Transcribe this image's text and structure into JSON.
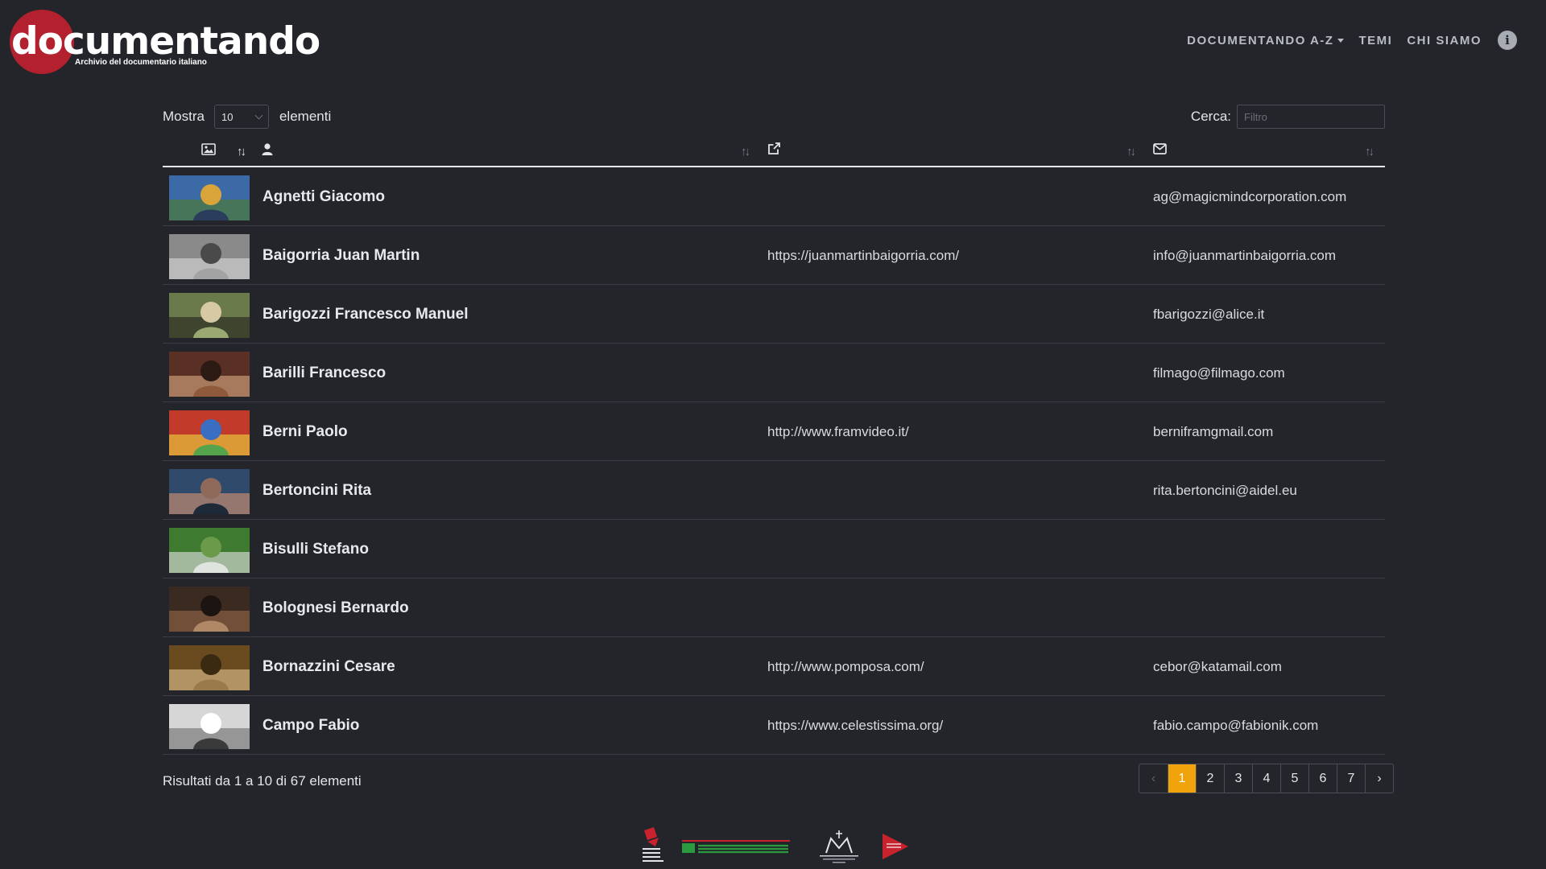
{
  "header": {
    "logo_text": "documentando",
    "logo_subtitle": "Archivio del documentario italiano",
    "nav": [
      {
        "label": "DOCUMENTANDO A-Z",
        "has_dropdown": true
      },
      {
        "label": "TEMI",
        "has_dropdown": false
      },
      {
        "label": "CHI SIAMO",
        "has_dropdown": false
      }
    ],
    "info_icon": "info-circle-icon"
  },
  "controls": {
    "show_label": "Mostra",
    "page_size": "10",
    "elements_label": "elementi",
    "search_label": "Cerca:",
    "search_placeholder": "Filtro"
  },
  "table": {
    "header_icons": [
      "image-icon",
      "user-icon",
      "external-link-icon",
      "envelope-icon"
    ],
    "rows": [
      {
        "name": "Agnetti Giacomo",
        "website": "",
        "email": "ag@magicmindcorporation.com"
      },
      {
        "name": "Baigorria Juan Martin",
        "website": "https://juanmartinbaigorria.com/",
        "email": "info@juanmartinbaigorria.com"
      },
      {
        "name": "Barigozzi Francesco Manuel",
        "website": "",
        "email": "fbarigozzi@alice.it"
      },
      {
        "name": "Barilli Francesco",
        "website": "",
        "email": "filmago@filmago.com"
      },
      {
        "name": "Berni Paolo",
        "website": "http://www.framvideo.it/",
        "email": "berniframgmail.com"
      },
      {
        "name": "Bertoncini Rita",
        "website": "",
        "email": "rita.bertoncini@aidel.eu"
      },
      {
        "name": "Bisulli Stefano",
        "website": "",
        "email": ""
      },
      {
        "name": "Bolognesi Bernardo",
        "website": "",
        "email": ""
      },
      {
        "name": "Bornazzini Cesare",
        "website": "http://www.pomposa.com/",
        "email": "cebor@katamail.com"
      },
      {
        "name": "Campo Fabio",
        "website": "https://www.celestissima.org/",
        "email": "fabio.campo@fabionik.com"
      }
    ]
  },
  "footer": {
    "info": "Risultati da 1 a 10 di 67 elementi",
    "pages": [
      "1",
      "2",
      "3",
      "4",
      "5",
      "6",
      "7"
    ],
    "current_page": "1",
    "logos": [
      "Emilia-Romagna Film Commission",
      "RegioneEmilia-Romagna",
      "Fondazione del Monte",
      "D-E-R"
    ]
  },
  "colors": {
    "background": "#23252b",
    "brand_red": "#b3202e",
    "pager_active": "#f0a30a"
  }
}
